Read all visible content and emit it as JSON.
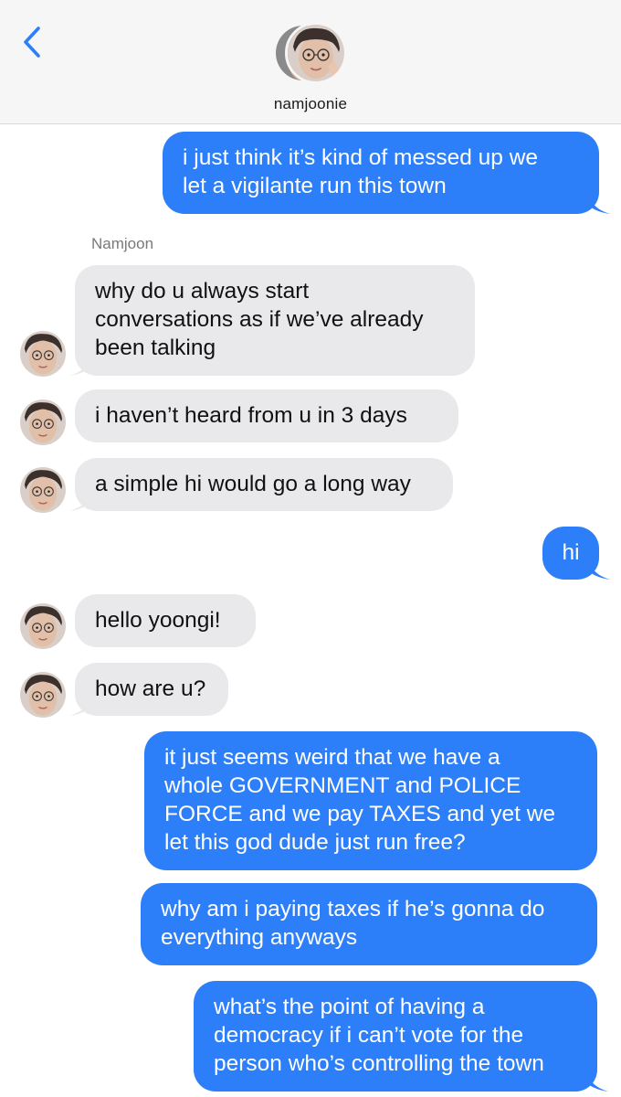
{
  "header": {
    "contact_name": "namjoonie",
    "back_icon": "chevron-left-icon"
  },
  "colors": {
    "sent_bubble": "#2d7ff9",
    "received_bubble": "#e9e9eb",
    "accent": "#2d7ff9"
  },
  "messages": [
    {
      "from": "me",
      "lines": [
        "i just think it’s kind of messed up we",
        "let a vigilante run this town"
      ]
    },
    {
      "from": "Namjoon",
      "sender_label": "Namjoon",
      "lines": [
        "why do u always start",
        "conversations as if we’ve already",
        "been talking"
      ]
    },
    {
      "from": "Namjoon",
      "lines": [
        "i haven’t heard from u in 3 days"
      ]
    },
    {
      "from": "Namjoon",
      "lines": [
        "a simple hi would go a long way"
      ]
    },
    {
      "from": "me",
      "lines": [
        "hi"
      ]
    },
    {
      "from": "Namjoon",
      "lines": [
        "hello yoongi!"
      ]
    },
    {
      "from": "Namjoon",
      "lines": [
        "how are u?"
      ]
    },
    {
      "from": "me",
      "lines": [
        "it just seems weird that we have a",
        "whole GOVERNMENT and POLICE",
        "FORCE and we pay TAXES and yet we",
        "let this god dude just run free?"
      ]
    },
    {
      "from": "me",
      "lines": [
        "why am i paying taxes if he’s gonna do",
        "everything anyways"
      ]
    },
    {
      "from": "me",
      "lines": [
        "what’s the point of having a",
        "democracy if i can’t vote for the",
        "person who’s controlling the town"
      ]
    }
  ]
}
